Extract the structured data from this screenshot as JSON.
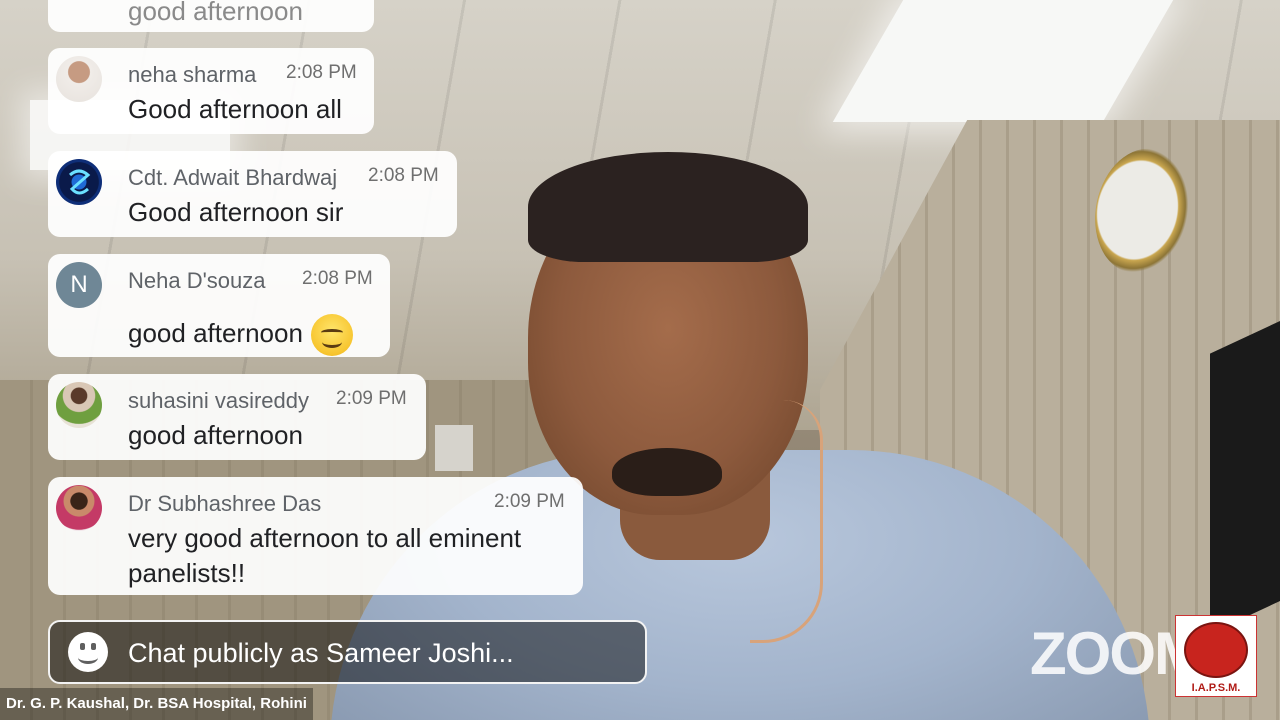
{
  "chat": {
    "partial_message": "good afternoon",
    "messages": [
      {
        "sender": "neha sharma",
        "time": "2:08 PM",
        "text": "Good afternoon all"
      },
      {
        "sender": "Cdt. Adwait Bhardwaj",
        "time": "2:08 PM",
        "text": "Good afternoon sir"
      },
      {
        "sender": "Neha D'souza",
        "time": "2:08 PM",
        "text": "good afternoon",
        "avatar_letter": "N"
      },
      {
        "sender": "suhasini vasireddy",
        "time": "2:09 PM",
        "text": "good afternoon"
      },
      {
        "sender": "Dr Subhashree Das",
        "time": "2:09 PM",
        "text_line1": "very good afternoon to all eminent",
        "text_line2": "panelists!!"
      }
    ],
    "input_placeholder": "Chat publicly as Sameer Joshi..."
  },
  "video": {
    "caption": "Dr. G. P. Kaushal, Dr. BSA Hospital, Rohini"
  },
  "branding": {
    "zoom_logo": "ZOOM",
    "org_logo": "I.A.P.S.M."
  },
  "colors": {
    "bubble": "#ffffff",
    "name_text": "#5f6368",
    "input_border": "#f3f3f3"
  }
}
